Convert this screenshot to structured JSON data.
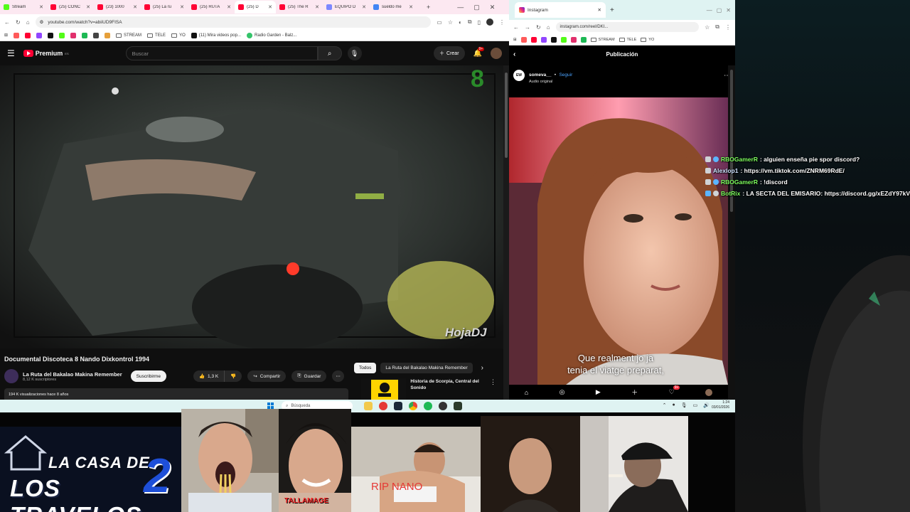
{
  "left_browser": {
    "tabs": [
      {
        "label": "Stream",
        "icon": "kick-favicon"
      },
      {
        "label": "(25) CONC",
        "icon": "youtube-favicon"
      },
      {
        "label": "(23) 1000",
        "icon": "youtube-favicon"
      },
      {
        "label": "(25) La ru",
        "icon": "youtube-favicon"
      },
      {
        "label": "(25) RUTA",
        "icon": "youtube-favicon"
      },
      {
        "label": "(25) D",
        "icon": "youtube-favicon"
      },
      {
        "label": "(25) The R",
        "icon": "youtube-favicon"
      },
      {
        "label": "EQUIPO D",
        "icon": "discord-favicon"
      },
      {
        "label": "sueldo me",
        "icon": "google-favicon"
      }
    ],
    "url": "youtube.com/watch?v=abiiUD9FISA",
    "bookmarks": [
      "STREAM",
      "TELE",
      "YO",
      "(11) Mira videos pop...",
      "Radio Garden - Balz..."
    ]
  },
  "youtube": {
    "premium_label": "Premium",
    "premium_sup": "ES",
    "search_placeholder": "Buscar",
    "create_label": "Crear",
    "notif_count": "9+",
    "video_watermark": "HojaDJ",
    "video_title": "Documental Discoteca 8 Nando Dixkontrol 1994",
    "channel_name": "La Ruta del Bakalao Makina Remember",
    "channel_subs": "8,12 K suscriptores",
    "subscribe_label": "Suscribirme",
    "likes": "1,3 K",
    "share_label": "Compartir",
    "save_label": "Guardar",
    "views_text": "194 K visualizaciones  hace 8 años",
    "chips": [
      "Todos",
      "La Ruta del Bakalao Makina Remember"
    ],
    "rec_title": "Historia de Scorpia, Central del Sonido"
  },
  "right_browser": {
    "tab_label": "Instagram",
    "url": "instagram.com/reel/DKI...",
    "header_title": "Publicación",
    "user": "someva__",
    "follow_label": "Seguir",
    "audio_label": "Audio original",
    "avatar_text": "EW",
    "caption_line1": "Que realment jo ja",
    "caption_line2": "tenia el viatge preparat,",
    "notif_count": "9+"
  },
  "taskbar": {
    "search_placeholder": "Búsqueda",
    "time": "1:24",
    "date": "03/01/2026"
  },
  "chat": [
    {
      "user": "RBOGamerR",
      "message": ": alguien enseña pie spor discord?",
      "user_color": "#7dff5e"
    },
    {
      "user": "Alexlop1",
      "message": ": https://vm.tiktok.com/ZNRM69RdE/",
      "user_color": "#cfe3ff"
    },
    {
      "user": "RBOGamerR",
      "message": ": !discord",
      "user_color": "#7dff5e"
    },
    {
      "user": "BotRix",
      "message": ": LA SECTA DEL EMISARIO: https://discord.gg/xEZdY97kV",
      "user_color": "#7dff5e"
    }
  ],
  "collage": {
    "logo_line1": "LA CASA DE",
    "logo_line2": "LOS TRAVELOS",
    "logo_number": "2",
    "photo2_text": "TALLAMAGE",
    "photo3_text": "RIP NANO"
  },
  "colors": {
    "youtube_red": "#ff0033",
    "kick_green": "#53fc18",
    "chat_green": "#7dff5e",
    "taskbar_bg": "#dff3f2"
  }
}
